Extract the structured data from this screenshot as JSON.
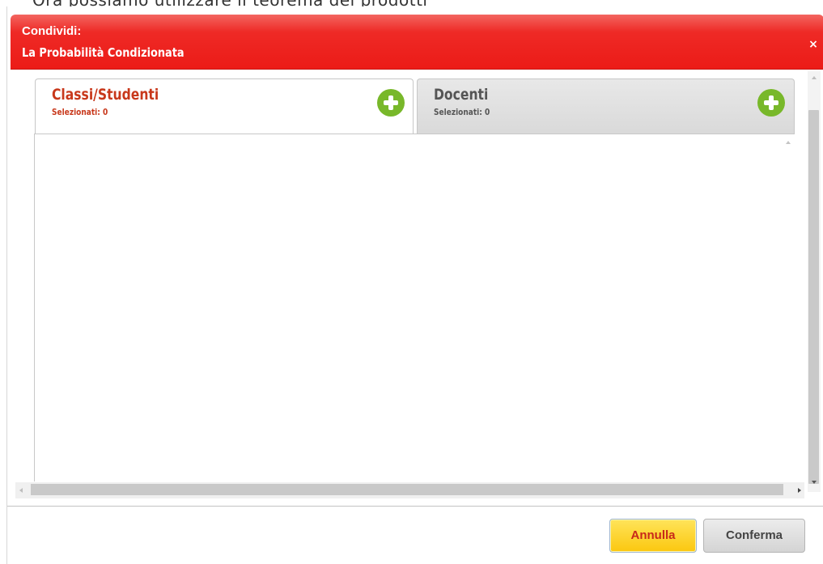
{
  "background_text": "Ora possiamo utilizzare il teorema dei prodotti",
  "dialog": {
    "header_line1": "Condividi:",
    "header_line2": "La Probabilità Condizionata",
    "close_glyph": "×",
    "header_color": "#ec1b17"
  },
  "tabs": [
    {
      "label": "Classi/Studenti",
      "subtitle": "Selezionati: 0",
      "active": true,
      "add_icon": "plus-circle-icon"
    },
    {
      "label": "Docenti",
      "subtitle": "Selezionati: 0",
      "active": false,
      "add_icon": "plus-circle-icon"
    }
  ],
  "footer": {
    "cancel_label": "Annulla",
    "confirm_label": "Conferma"
  },
  "colors": {
    "accent_red": "#c8381b",
    "add_green": "#78b82a",
    "cancel_yellow": "#fbc70f"
  }
}
